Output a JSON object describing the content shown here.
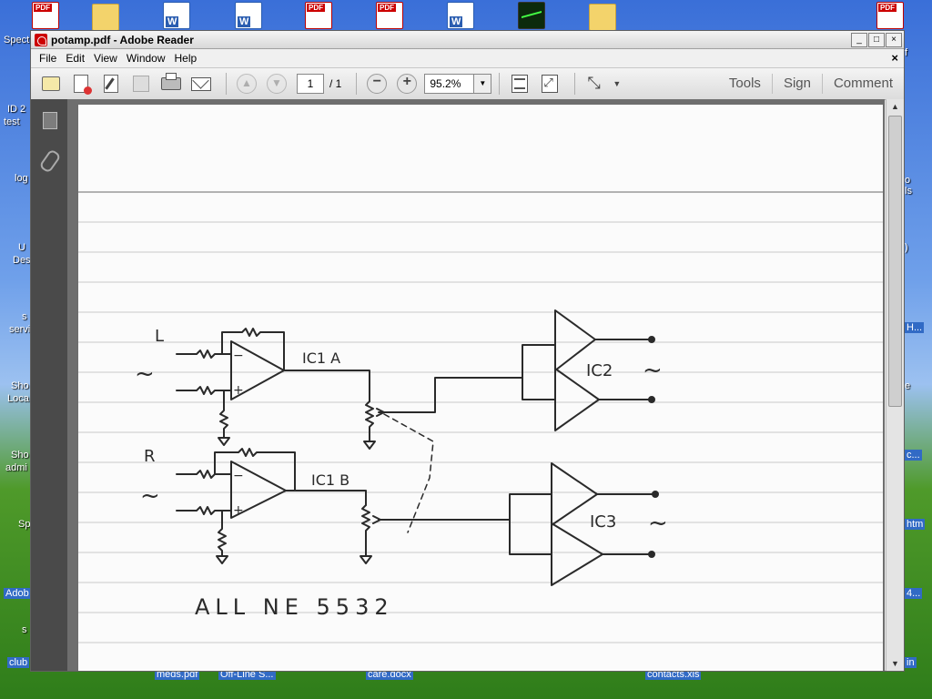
{
  "desktop": {
    "left_labels": [
      "Spect",
      "ID 2",
      "test",
      "log",
      "U",
      "Des",
      "s",
      "servi",
      "Sho",
      "Loca",
      "Sho",
      "admi",
      "Sp",
      "Adob",
      "s",
      "club"
    ],
    "right_labels": [
      "f",
      "o",
      "ls",
      ")",
      "H...",
      "e",
      "c...",
      "htm",
      "4...",
      "in"
    ],
    "bottom_labels": [
      "meds.pdf",
      "Off-Line S...",
      "care.docx",
      "contacts.xls"
    ]
  },
  "window": {
    "title": "potamp.pdf - Adobe Reader",
    "min_btn": "_",
    "max_btn": "□",
    "close_btn": "×",
    "doc_close": "×"
  },
  "menu": [
    "File",
    "Edit",
    "View",
    "Window",
    "Help"
  ],
  "toolbar": {
    "page_current": "1",
    "page_total": "/ 1",
    "zoom": "95.2%",
    "zoom_arrow": "▼",
    "right_links": [
      "Tools",
      "Sign",
      "Comment"
    ]
  },
  "scrollbar": {
    "up": "▲",
    "down": "▼"
  },
  "document": {
    "handwriting": {
      "L": "L",
      "R": "R",
      "tilde": "~",
      "plus": "+",
      "minus": "−",
      "ic1a": "IC1 A",
      "ic1b": "IC1 B",
      "ic2": "IC2",
      "ic3": "IC3",
      "note": "ALL NE 5532"
    }
  }
}
